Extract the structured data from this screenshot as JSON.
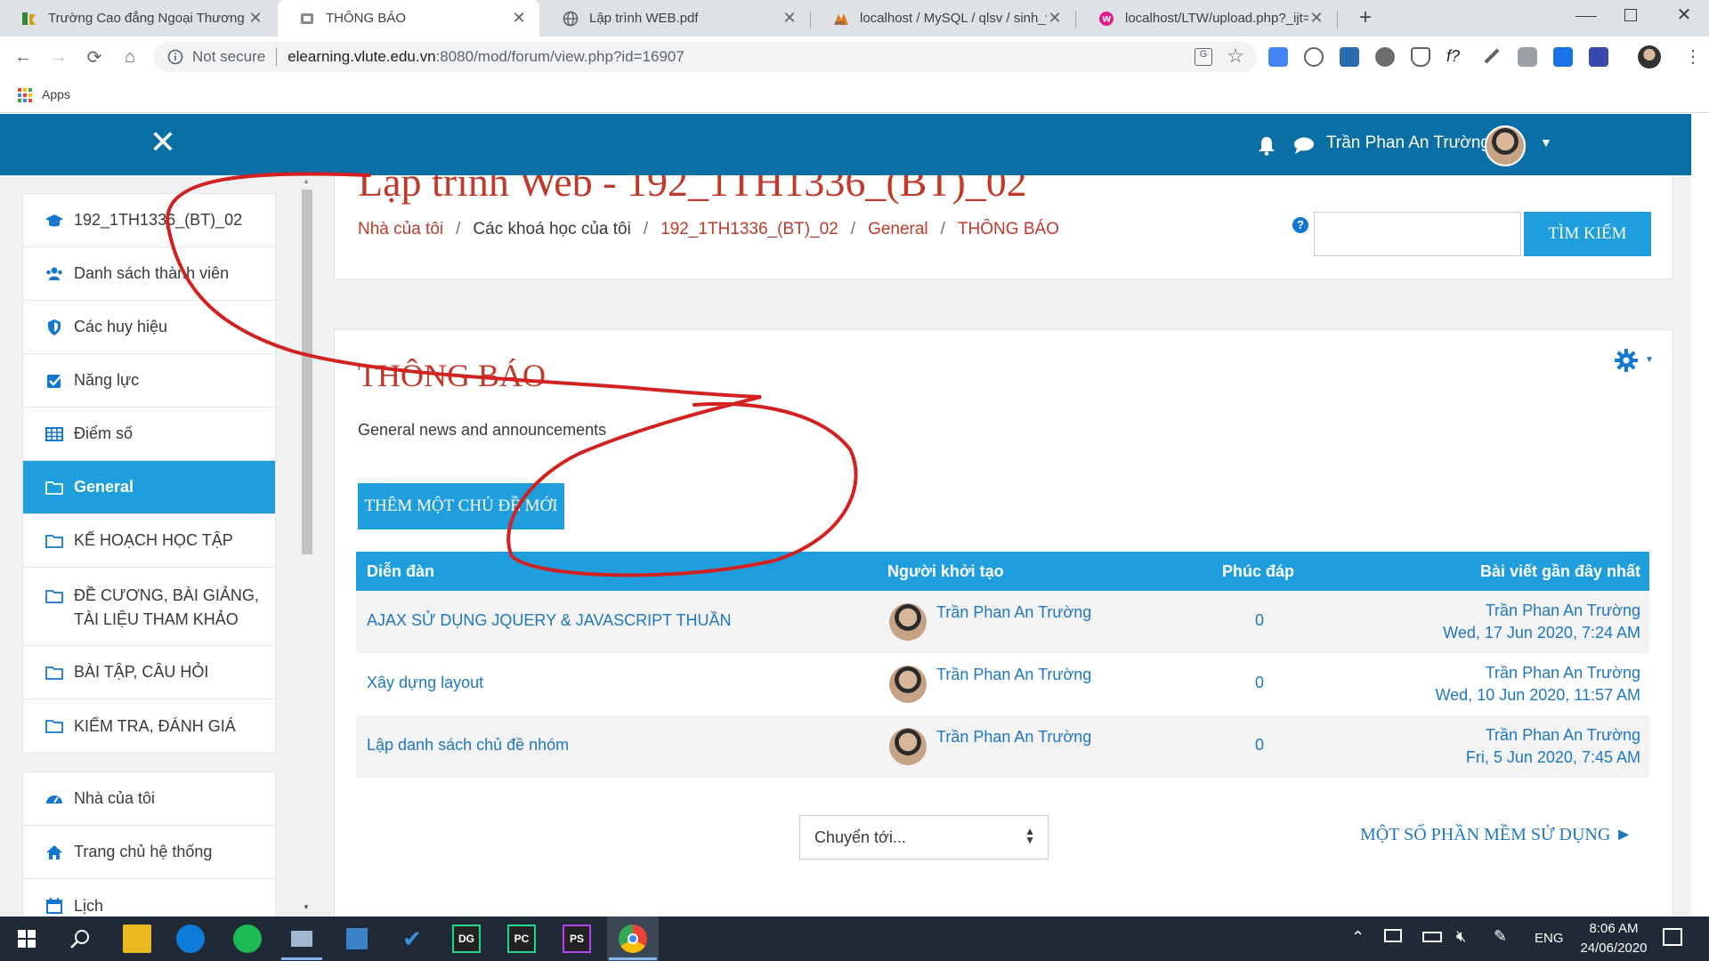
{
  "browser": {
    "tabs": [
      {
        "title": "Trường Cao đẳng Ngoại Thương",
        "close": "✕"
      },
      {
        "title": "THÔNG BÁO",
        "close": "✕"
      },
      {
        "title": "Lập trình WEB.pdf",
        "close": "✕"
      },
      {
        "title": "localhost / MySQL / qlsv / sinh_v",
        "close": "✕"
      },
      {
        "title": "localhost/LTW/upload.php?_ijt=c",
        "close": "✕"
      }
    ],
    "new_tab": "+",
    "security": "Not secure",
    "url_host": "elearning.vlute.edu.vn",
    "url_rest": ":8080/mod/forum/view.php?id=16907",
    "bookmarks_apps": "Apps"
  },
  "navbar": {
    "close_symbol": "✕",
    "user_name": "Trần Phan An Trường",
    "accent": "#0a6fa4"
  },
  "sidebar": {
    "course_items": [
      {
        "label": "192_1TH1336_(BT)_02",
        "icon": "graduation-cap-icon"
      },
      {
        "label": "Danh sách thành viên",
        "icon": "users-icon"
      },
      {
        "label": "Các huy hiệu",
        "icon": "shield-icon"
      },
      {
        "label": "Năng lực",
        "icon": "checkbox-icon"
      },
      {
        "label": "Điểm số",
        "icon": "table-icon"
      },
      {
        "label": "General",
        "icon": "folder-icon",
        "active": true
      },
      {
        "label": "KẾ HOẠCH HỌC TẬP",
        "icon": "folder-icon"
      },
      {
        "label": "ĐỀ CƯƠNG, BÀI GIẢNG, TÀI LIỆU THAM KHẢO",
        "icon": "folder-icon"
      },
      {
        "label": "BÀI TẬP, CÂU HỎI",
        "icon": "folder-icon"
      },
      {
        "label": "KIỂM TRA, ĐÁNH GIÁ",
        "icon": "folder-icon"
      }
    ],
    "site_items": [
      {
        "label": "Nhà của tôi",
        "icon": "dashboard-icon"
      },
      {
        "label": "Trang chủ hệ thống",
        "icon": "home-icon"
      },
      {
        "label": "Lịch",
        "icon": "calendar-icon"
      }
    ]
  },
  "header": {
    "course_title": "Lập trình Web - 192_1TH1336_(BT)_02",
    "breadcrumb": [
      "Nhà của tôi",
      "Các khoá học của tôi",
      "192_1TH1336_(BT)_02",
      "General",
      "THÔNG BÁO"
    ],
    "breadcrumb_sep": "/",
    "search_placeholder": "",
    "search_button": "TÌM KIẾM",
    "help_symbol": "?"
  },
  "forum": {
    "title": "THÔNG BÁO",
    "description": "General news and announcements",
    "add_button": "THÊM MỘT CHỦ ĐỀ MỚI",
    "columns": [
      "Diễn đàn",
      "Người khởi tạo",
      "Phúc đáp",
      "Bài viết gần đây nhất"
    ],
    "rows": [
      {
        "topic": "AJAX SỬ DỤNG JQUERY & JAVASCRIPT THUẦN",
        "author": "Trần Phan An Trường",
        "replies": "0",
        "last_author": "Trần Phan An Trường",
        "last_date": "Wed, 17 Jun 2020, 7:24 AM"
      },
      {
        "topic": "Xây dựng layout",
        "author": "Trần Phan An Trường",
        "replies": "0",
        "last_author": "Trần Phan An Trường",
        "last_date": "Wed, 10 Jun 2020, 11:57 AM"
      },
      {
        "topic": "Lập danh sách chủ đề nhóm",
        "author": "Trần Phan An Trường",
        "replies": "0",
        "last_author": "Trần Phan An Trường",
        "last_date": "Fri, 5 Jun 2020, 7:45 AM"
      }
    ],
    "jump_select": "Chuyển tới...",
    "next_activity": "MỘT SỐ PHẦN MỀM SỬ DỤNG ►"
  },
  "taskbar": {
    "lang": "ENG",
    "time": "8:06 AM",
    "date": "24/06/2020"
  }
}
